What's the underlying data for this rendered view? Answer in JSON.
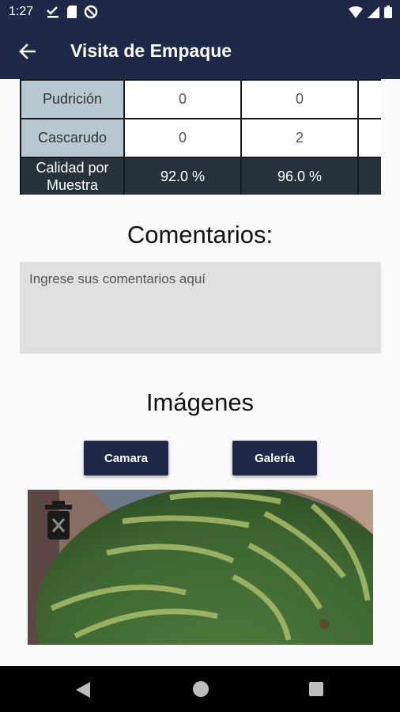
{
  "status_bar": {
    "time": "1:27",
    "left_icons": [
      "download-done-icon",
      "sd-card-icon",
      "do-not-disturb-icon"
    ],
    "right_icons": [
      "wifi-icon",
      "signal-icon",
      "battery-icon"
    ]
  },
  "app_bar": {
    "title": "Visita de Empaque",
    "back_icon": "arrow-back-icon"
  },
  "quality_table": {
    "rows": [
      {
        "label": "Pudrición",
        "values": [
          "0",
          "0",
          ""
        ]
      },
      {
        "label": "Cascarudo",
        "values": [
          "0",
          "2",
          ""
        ]
      }
    ],
    "total": {
      "label_line1": "Calidad por",
      "label_line2": "Muestra",
      "values": [
        "92.0 %",
        "96.0 %",
        ""
      ]
    }
  },
  "comments": {
    "title": "Comentarios:",
    "placeholder": "Ingrese sus comentarios aquí",
    "value": ""
  },
  "images": {
    "title": "Imágenes",
    "camera_label": "Camara",
    "gallery_label": "Galería",
    "photo_subject": "watermelon",
    "delete_icon": "delete-image-icon"
  },
  "colors": {
    "primary": "#1d2946",
    "row_label_bg": "#b8c8d2",
    "total_row_bg": "#26323c",
    "input_bg": "#e0e0e0"
  }
}
